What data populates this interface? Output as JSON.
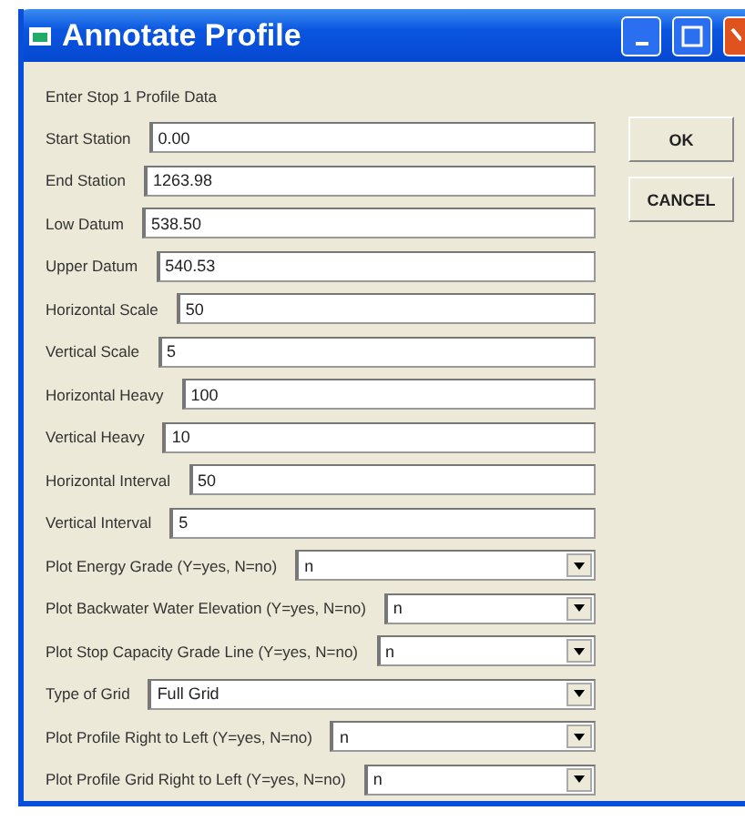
{
  "window": {
    "title": "Annotate Profile"
  },
  "heading": "Enter Stop 1 Profile Data",
  "fields": [
    {
      "kind": "text",
      "label": "Start Station",
      "value": "0.00"
    },
    {
      "kind": "text",
      "label": "End Station",
      "value": "1263.98"
    },
    {
      "kind": "text",
      "label": "Low Datum",
      "value": "538.50"
    },
    {
      "kind": "text",
      "label": "Upper Datum",
      "value": "540.53"
    },
    {
      "kind": "text",
      "label": "Horizontal Scale",
      "value": "50"
    },
    {
      "kind": "text",
      "label": "Vertical Scale",
      "value": "5"
    },
    {
      "kind": "text",
      "label": "Horizontal Heavy",
      "value": "100"
    },
    {
      "kind": "text",
      "label": "Vertical Heavy",
      "value": "10"
    },
    {
      "kind": "text",
      "label": "Horizontal Interval",
      "value": "50"
    },
    {
      "kind": "text",
      "label": "Vertical Interval",
      "value": "5"
    },
    {
      "kind": "combo",
      "label": "Plot Energy Grade (Y=yes, N=no)",
      "value": "n"
    },
    {
      "kind": "combo",
      "label": "Plot Backwater Water Elevation (Y=yes, N=no)",
      "value": "n"
    },
    {
      "kind": "combo",
      "label": "Plot Stop Capacity Grade Line (Y=yes, N=no)",
      "value": "n"
    },
    {
      "kind": "combo",
      "label": "Type of Grid",
      "value": "Full Grid"
    },
    {
      "kind": "combo",
      "label": "Plot Profile Right to Left (Y=yes, N=no)",
      "value": "n"
    },
    {
      "kind": "combo",
      "label": "Plot Profile Grid Right to Left (Y=yes, N=no)",
      "value": "n"
    }
  ],
  "buttons": [
    "OK",
    "CANCEL"
  ]
}
